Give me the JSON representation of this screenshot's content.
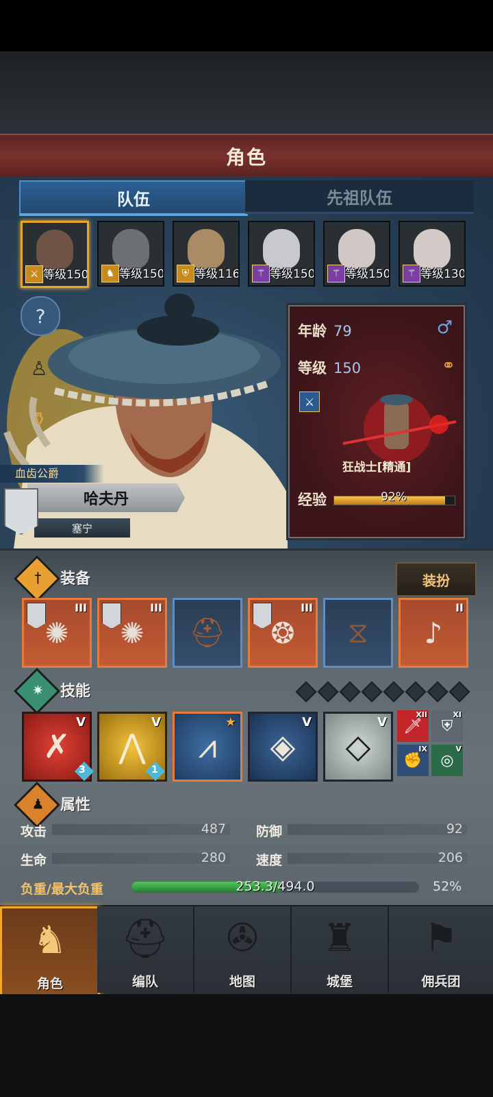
{
  "header": {
    "title": "角色"
  },
  "tabs": [
    {
      "label": "队伍",
      "active": true
    },
    {
      "label": "先祖队伍",
      "active": false
    }
  ],
  "party": [
    {
      "level_text": "等级150",
      "class_icon": "sword-icon",
      "selected": true
    },
    {
      "level_text": "等级150",
      "class_icon": "horse-icon",
      "selected": false
    },
    {
      "level_text": "等级116",
      "class_icon": "shield-icon",
      "selected": false
    },
    {
      "level_text": "等级150",
      "class_icon": "staff-icon",
      "selected": false
    },
    {
      "level_text": "等级150",
      "class_icon": "staff-icon",
      "selected": false
    },
    {
      "level_text": "等级130",
      "class_icon": "staff-icon",
      "selected": false
    }
  ],
  "hero": {
    "title": "血齿公爵",
    "name": "哈夫丹",
    "home": "塞宁",
    "age_label": "年龄",
    "age_value": "79",
    "level_label": "等级",
    "level_value": "150",
    "class_name": "狂战士[精通]",
    "exp_label": "经验",
    "exp_text": "92%",
    "exp_fraction": 0.92
  },
  "equipment": {
    "title": "装备",
    "outfit_button": "装扮",
    "slots": [
      {
        "rank": "III",
        "icon": "claw-weapon-icon",
        "rarity": "orange"
      },
      {
        "rank": "III",
        "icon": "claw-weapon-icon",
        "rarity": "orange"
      },
      {
        "rank": "",
        "icon": "helmet-icon",
        "rarity": "blue"
      },
      {
        "rank": "III",
        "icon": "fur-armor-icon",
        "rarity": "orange"
      },
      {
        "rank": "",
        "icon": "boots-icon",
        "rarity": "blue"
      },
      {
        "rank": "II",
        "icon": "horn-icon",
        "rarity": "orange"
      }
    ]
  },
  "skills": {
    "title": "技能",
    "slots": [
      {
        "rank": "V",
        "icon": "slash-skill-icon",
        "badge": "3"
      },
      {
        "rank": "V",
        "icon": "claw-strike-icon",
        "badge": "1"
      },
      {
        "rank": "★",
        "icon": "triple-claw-icon",
        "badge": ""
      },
      {
        "rank": "V",
        "icon": "crystal-sword-icon",
        "badge": ""
      },
      {
        "rank": "V",
        "icon": "crystal-arm-icon",
        "badge": ""
      }
    ],
    "passives": [
      {
        "rank": "XII",
        "icon": "sword-icon"
      },
      {
        "rank": "XI",
        "icon": "shield-icon"
      },
      {
        "rank": "IX",
        "icon": "fist-icon"
      },
      {
        "rank": "V",
        "icon": "target-icon"
      }
    ]
  },
  "attributes": {
    "title": "属性",
    "items": [
      {
        "label": "攻击",
        "value": "487"
      },
      {
        "label": "防御",
        "value": "92"
      },
      {
        "label": "生命",
        "value": "280"
      },
      {
        "label": "速度",
        "value": "206"
      }
    ],
    "load_label": "负重/最大负重",
    "load_text": "253.3/494.0",
    "load_pct": "52%",
    "load_fraction": 0.52
  },
  "nav": [
    {
      "label": "角色",
      "icon": "knight-icon",
      "active": true
    },
    {
      "label": "编队",
      "icon": "helmet-icon",
      "active": false
    },
    {
      "label": "地图",
      "icon": "compass-icon",
      "active": false
    },
    {
      "label": "城堡",
      "icon": "castle-icon",
      "active": false
    },
    {
      "label": "佣兵团",
      "icon": "banner-icon",
      "active": false
    }
  ],
  "colors": {
    "accent_orange": "#f4a630",
    "rare_blue": "#5d8ec6",
    "epic_orange": "#e57b3f",
    "load_green": "#3fae4a"
  }
}
